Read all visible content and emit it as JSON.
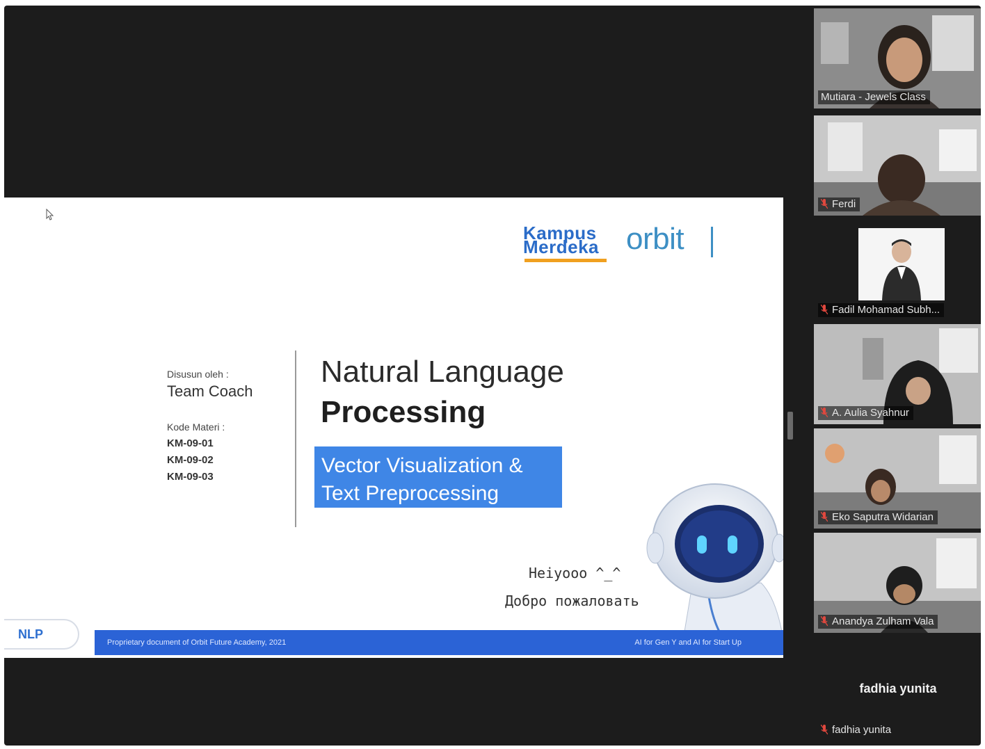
{
  "slide": {
    "logo_kampus_line1": "Kampus",
    "logo_kampus_line2": "Merdeka",
    "logo_orbit": "orbit",
    "author_label": "Disusun oleh :",
    "author": "Team Coach",
    "code_label": "Kode Materi :",
    "codes": [
      "KM-09-01",
      "KM-09-02",
      "KM-09-03"
    ],
    "title_line1": "Natural Language",
    "title_line2": "Processing",
    "subtitle_line1": "Vector Visualization &",
    "subtitle_line2": "Text Preprocessing",
    "greeting_line1": "Heiyooo ^_^",
    "greeting_line2": "Добро пожаловать",
    "badge": "NLP",
    "footer_left": "Proprietary document of Orbit Future Academy, 2021",
    "footer_right": "AI for Gen Y and AI for Start Up"
  },
  "participants": [
    {
      "name": "Mutiara - Jewels Class",
      "active": true
    },
    {
      "name": "Ferdi"
    },
    {
      "name": "Fadil Mohamad Subh..."
    },
    {
      "name": "A. Aulia Syahnur"
    },
    {
      "name": "Eko Saputra Widarian"
    },
    {
      "name": "Anandya Zulham Vala"
    },
    {
      "name": "fadhia yunita",
      "display_name": "fadhia yunita"
    }
  ],
  "colors": {
    "active_border": "#b9d66a",
    "slide_accent": "#3f86e6",
    "footer_bar": "#2b63d6",
    "mic_muted": "#e0483e"
  }
}
